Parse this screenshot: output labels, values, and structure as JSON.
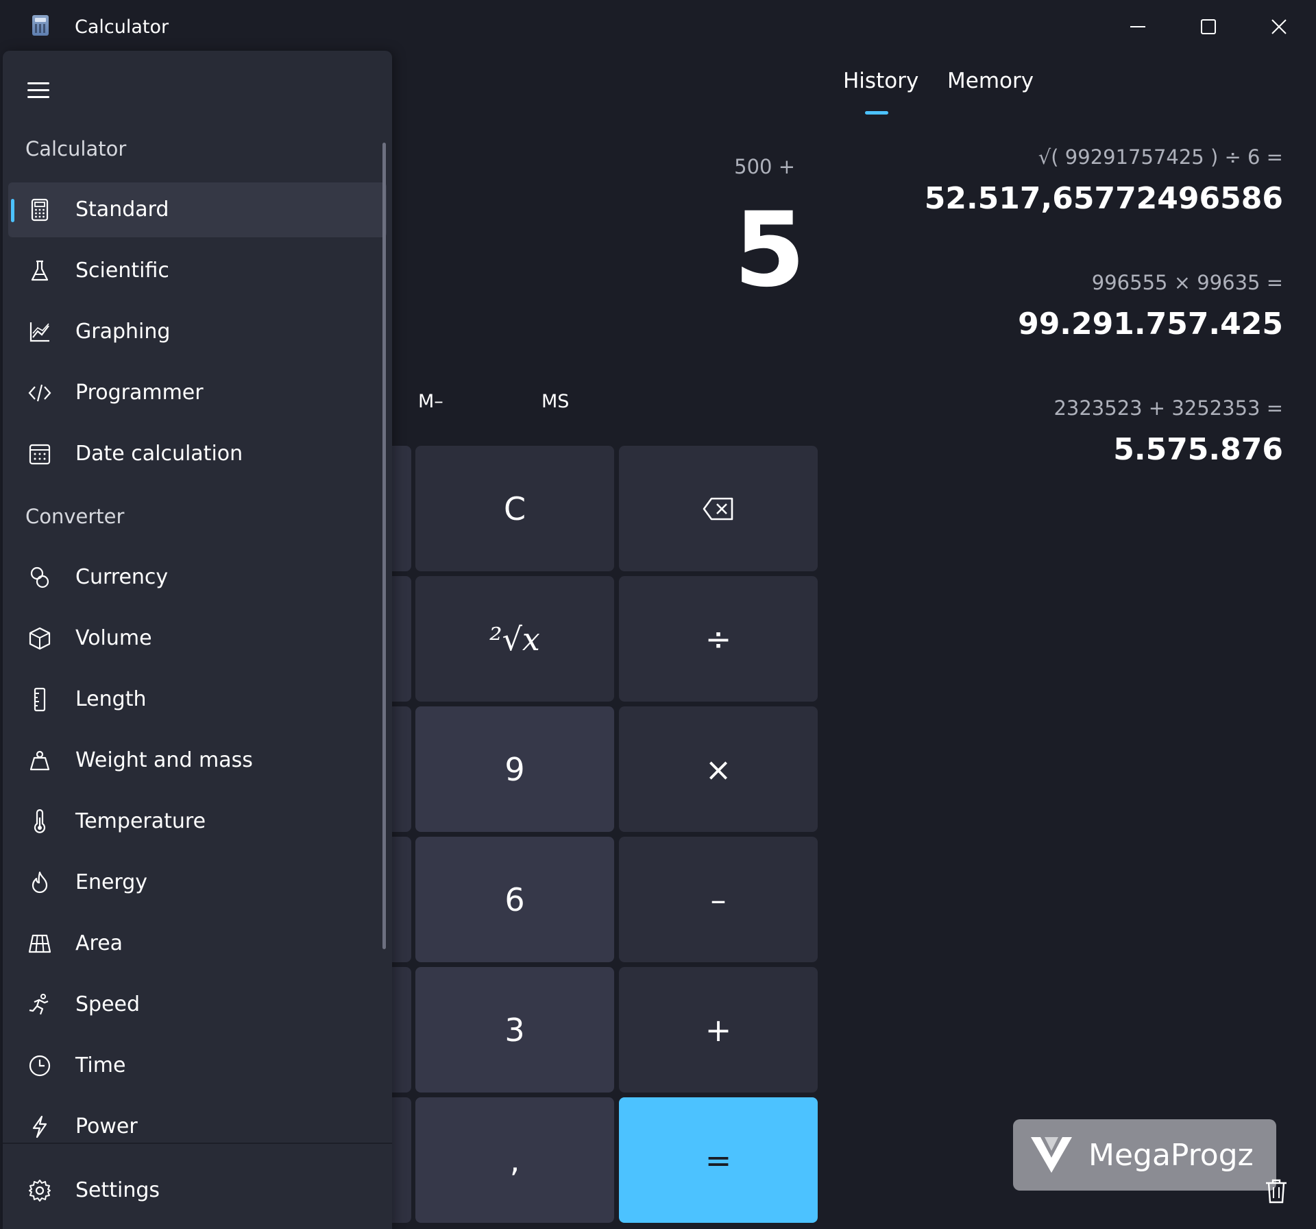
{
  "window": {
    "title": "Calculator",
    "controls": [
      "minimize-icon",
      "maximize-icon",
      "close-icon"
    ]
  },
  "nav": {
    "menu_icon": "hamburger-icon",
    "section_calculator": "Calculator",
    "section_converter": "Converter",
    "calculator_items": [
      {
        "label": "Standard",
        "icon": "calculator-icon",
        "selected": true
      },
      {
        "label": "Scientific",
        "icon": "flask-icon"
      },
      {
        "label": "Graphing",
        "icon": "graph-icon"
      },
      {
        "label": "Programmer",
        "icon": "code-icon"
      },
      {
        "label": "Date calculation",
        "icon": "calendar-icon"
      }
    ],
    "converter_items": [
      {
        "label": "Currency",
        "icon": "currency-icon"
      },
      {
        "label": "Volume",
        "icon": "cube-icon"
      },
      {
        "label": "Length",
        "icon": "ruler-icon"
      },
      {
        "label": "Weight and mass",
        "icon": "weight-icon"
      },
      {
        "label": "Temperature",
        "icon": "thermometer-icon"
      },
      {
        "label": "Energy",
        "icon": "flame-icon"
      },
      {
        "label": "Area",
        "icon": "grid-icon"
      },
      {
        "label": "Speed",
        "icon": "runner-icon"
      },
      {
        "label": "Time",
        "icon": "clock-icon"
      },
      {
        "label": "Power",
        "icon": "lightning-icon"
      }
    ],
    "settings": "Settings"
  },
  "tabs": {
    "history": "History",
    "memory": "Memory",
    "active": "history"
  },
  "calc": {
    "expression": "500 +",
    "display": "5",
    "memory": {
      "m_minus": "M–",
      "ms": "MS"
    },
    "keys": {
      "clear": "C",
      "backspace_icon": "backspace-icon",
      "sqrt": "²√x",
      "divide": "÷",
      "nine": "9",
      "multiply": "×",
      "six": "6",
      "minus": "–",
      "three": "3",
      "plus": "+",
      "comma": ",",
      "equals": "="
    },
    "accent_color": "#4cc2ff"
  },
  "history": [
    {
      "expression": "√( 99291757425 )   ÷   6 =",
      "result": "52.517,6577249658​6"
    },
    {
      "expression": "996555   ×   99635 =",
      "result": "99.291.757.425"
    },
    {
      "expression": "2323523   +   3252353 =",
      "result": "5.575.876"
    }
  ],
  "history_delete_icon": "trash-icon",
  "watermark": {
    "text": "MegaProgz"
  }
}
